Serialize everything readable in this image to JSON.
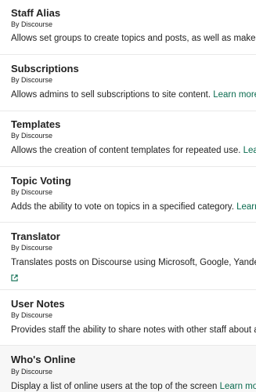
{
  "plugins": [
    {
      "name": "Staff Alias",
      "author": "By Discourse",
      "description": "Allows set groups to create topics and posts, as well as make edits",
      "link": ""
    },
    {
      "name": "Subscriptions",
      "author": "By Discourse",
      "description": "Allows admins to sell subscriptions to site content.",
      "link": "Learn more"
    },
    {
      "name": "Templates",
      "author": "By Discourse",
      "description": "Allows the creation of content templates for repeated use.",
      "link": "Learn mo"
    },
    {
      "name": "Topic Voting",
      "author": "By Discourse",
      "description": "Adds the ability to vote on topics in a specified category.",
      "link": "Learn mo"
    },
    {
      "name": "Translator",
      "author": "By Discourse",
      "description": "Translates posts on Discourse using Microsoft, Google, Yandex or",
      "link": ""
    },
    {
      "name": "User Notes",
      "author": "By Discourse",
      "description": "Provides staff the ability to share notes with other staff about a user",
      "link": ""
    },
    {
      "name": "Who's Online",
      "author": "By Discourse",
      "description": "Display a list of online users at the top of the screen",
      "link": "Learn more"
    }
  ],
  "icons": {
    "external": "external-link-icon"
  },
  "colors": {
    "link": "#0a6b4f",
    "text": "#222222",
    "divider": "#e9e9e9"
  }
}
